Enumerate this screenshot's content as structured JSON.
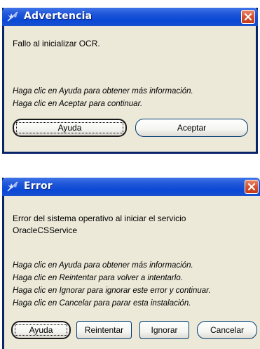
{
  "dialogs": [
    {
      "title": "Advertencia",
      "message_lines": [
        "Fallo al inicializar OCR."
      ],
      "hint_lines": [
        "Haga clic en Ayuda para obtener más información.",
        "Haga clic en Aceptar para continuar."
      ],
      "buttons": [
        {
          "label": "Ayuda"
        },
        {
          "label": "Aceptar"
        }
      ]
    },
    {
      "title": "Error",
      "message_lines": [
        "Error del sistema operativo al iniciar el servicio",
        "OracleCSService"
      ],
      "hint_lines": [
        "Haga clic en Ayuda para obtener más información.",
        "Haga clic en Reintentar para volver a intentarlo.",
        "Haga clic en Ignorar para ignorar este error y continuar.",
        "Haga clic en Cancelar para parar esta instalación."
      ],
      "buttons": [
        {
          "label": "Ayuda"
        },
        {
          "label": "Reintentar"
        },
        {
          "label": "Ignorar"
        },
        {
          "label": "Cancelar"
        }
      ]
    }
  ],
  "colors": {
    "titlebar": "#0a48d6",
    "dialog_bg": "#ece9d8",
    "close_button": "#d4502e"
  },
  "icons": [
    "app-feather-icon",
    "close-icon"
  ]
}
